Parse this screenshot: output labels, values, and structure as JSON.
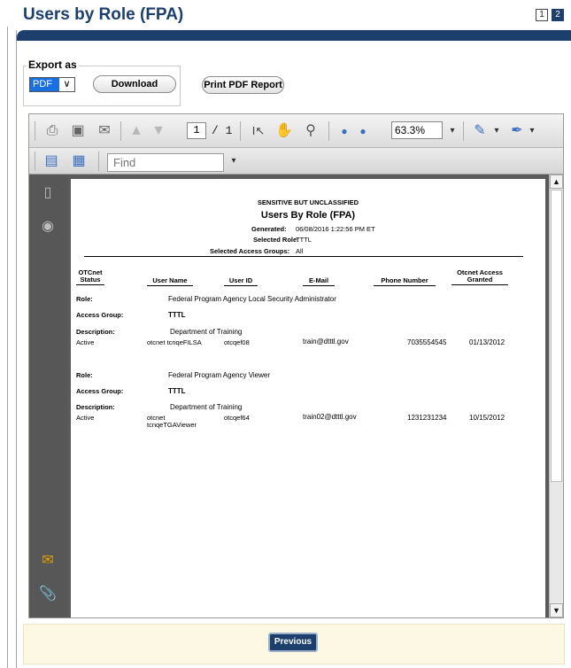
{
  "page": {
    "title": "Users by Role (FPA)",
    "pages": [
      "1",
      "2"
    ]
  },
  "export": {
    "legend": "Export as",
    "selected_format": "PDF",
    "download_label": "Download",
    "print_label": "Print PDF Report"
  },
  "viewer": {
    "page_current": "1",
    "page_total": "/ 1",
    "zoom": "63.3%",
    "find_placeholder": "Find",
    "icons": [
      "print-icon",
      "save-icon",
      "email-icon",
      "prev-page-icon",
      "next-page-icon",
      "select-tool-icon",
      "hand-tool-icon",
      "marquee-zoom-icon",
      "zoom-out-icon",
      "zoom-in-icon",
      "sign-icon",
      "annotate-icon",
      "fit-page-icon",
      "fit-width-icon",
      "pages-panel-icon",
      "binoculars-icon",
      "comments-icon",
      "attachments-icon"
    ]
  },
  "report": {
    "classification": "SENSITIVE BUT UNCLASSIFIED",
    "title": "Users By Role (FPA)",
    "generated_label": "Generated:",
    "generated_value": "06/08/2016 1:22:56 PM ET",
    "role_label": "Selected Role:",
    "role_value": "TTTL",
    "groups_label": "Selected Access Groups:",
    "groups_value": "All",
    "columns": {
      "status": "OTCnet Status",
      "username": "User Name",
      "userid": "User ID",
      "email": "E-Mail",
      "phone": "Phone Number",
      "granted": "Otcnet Access Granted"
    },
    "labels": {
      "role": "Role:",
      "access_group": "Access Group:",
      "description": "Description:"
    },
    "groups": [
      {
        "role": "Federal Program Agency Local Security Administrator",
        "access_group": "TTTL",
        "description": "Department of Training",
        "status": "Active",
        "username": "otcnet tcnqeFILSA",
        "userid": "otcqef08",
        "email": "train@dtttl.gov",
        "phone": "7035554545",
        "granted": "01/13/2012"
      },
      {
        "role": "Federal Program Agency Viewer",
        "access_group": "TTTL",
        "description": "Department of Training",
        "status": "Active",
        "username": "otcnet tcnqeTGAViewer",
        "userid": "otcqef64",
        "email": "train02@dtttl.gov",
        "phone": "1231231234",
        "granted": "10/15/2012"
      }
    ]
  },
  "footer": {
    "previous_label": "Previous"
  },
  "colors": {
    "brand_navy": "#1c3f6e",
    "select_blue": "#1a6fe0",
    "footer_band": "#fdf8e4"
  }
}
